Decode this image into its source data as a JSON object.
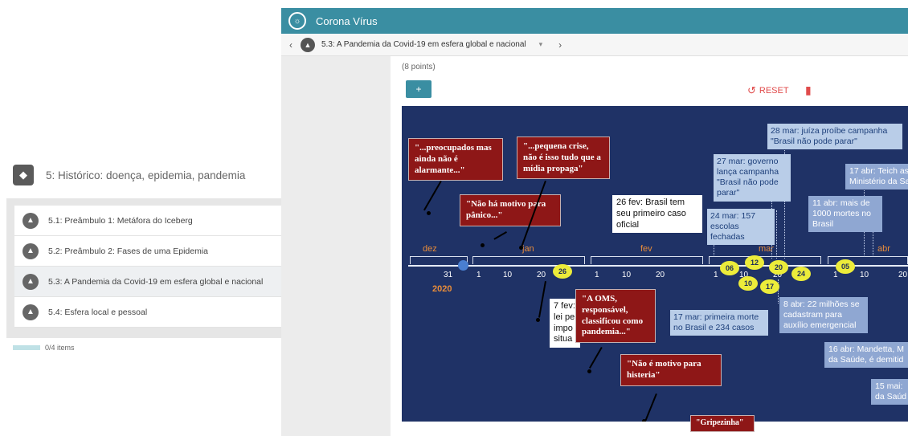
{
  "left_panel": {
    "title": "5: Histórico: doença, epidemia, pandemia",
    "items": [
      {
        "label": "5.1: Preâmbulo 1: Metáfora do Iceberg"
      },
      {
        "label": "5.2: Preâmbulo 2: Fases de uma Epidemia"
      },
      {
        "label": "5.3: A Pandemia da Covid-19 em esfera global e nacional"
      },
      {
        "label": "5.4: Esfera local e pessoal"
      }
    ],
    "progress_text": "0/4 items"
  },
  "header": {
    "app_title": "Corona Vírus"
  },
  "nav": {
    "current": "5.3: A Pandemia da Covid-19 em esfera global e nacional"
  },
  "content": {
    "points": "(8 points)",
    "add_label": "+",
    "reset_label": "RESET"
  },
  "timeline": {
    "months": [
      "dez",
      "jan",
      "fev",
      "mar",
      "abr"
    ],
    "ticks": [
      "31",
      "1",
      "10",
      "20",
      "1",
      "10",
      "20",
      "1",
      "10",
      "20",
      "1",
      "10",
      "20"
    ],
    "year": "2020",
    "dots": [
      "26",
      "06",
      "12",
      "20",
      "10",
      "17",
      "24",
      "05"
    ],
    "quotes": [
      "\"...preocupados mas ainda não é alarmante...\"",
      "\"...pequena crise, não é isso tudo que a mídia propaga\"",
      "\"Não há motivo para pânico...\"",
      "\"A OMS, responsável, classificou como pandemia...\"",
      "\"Não é motivo para histeria\"",
      "\"Gripezinha\""
    ],
    "events": [
      "28 mar: juíza proíbe campanha \"Brasil não pode parar\"",
      "27 mar: governo lança campanha \"Brasil não pode parar\"",
      "17 abr: Teich as Ministério da Sa",
      "26 fev: Brasil tem seu primeiro caso oficial",
      "24 mar: 157 escolas fechadas",
      "11 abr: mais de 1000 mortes no Brasil",
      "7 fev: lei pe impo situa",
      "17 mar: primeira morte no Brasil e 234 casos",
      "8 abr: 22 milhões se cadastram para auxílio emergencial",
      "16 abr: Mandetta, M da Saúde, é demitid",
      "15 mai: da Saúd"
    ]
  }
}
